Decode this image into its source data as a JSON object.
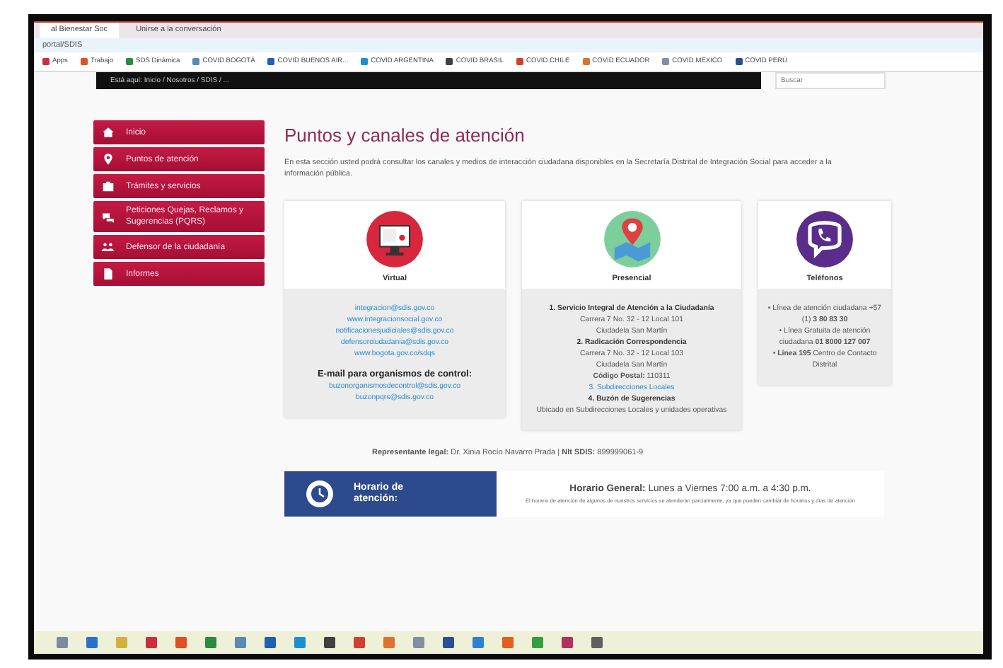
{
  "browser": {
    "tabs": [
      {
        "label": "al Bienestar Soc",
        "selected": true
      },
      {
        "label": "Unirse a la conversación",
        "selected": false
      }
    ],
    "address": "portal/SDIS",
    "bookmarks": [
      "Apps",
      "Trabajo",
      "SDS Dinámica",
      "COVID BOGOTÁ",
      "COVID BUENOS AIR...",
      "COVID ARGENTINA",
      "COVID BRASIL",
      "COVID CHILE",
      "COVID ECUADOR",
      "COVID MÉXICO",
      "COVID PERÚ"
    ]
  },
  "breadcrumb": "Está aquí: Inicio / Nosotros / SDIS / ...",
  "search": {
    "placeholder": "Buscar"
  },
  "sidebar": {
    "items": [
      {
        "label": "Inicio"
      },
      {
        "label": "Puntos de atención"
      },
      {
        "label": "Trámites y servicios"
      },
      {
        "label": "Peticiones Quejas, Reclamos y Sugerencias (PQRS)"
      },
      {
        "label": "Defensor de la ciudadanía"
      },
      {
        "label": "Informes"
      }
    ]
  },
  "heading": "Puntos y canales de atención",
  "intro": "En esta sección usted podrá consultar los canales y medios de interacción ciudadana disponibles en la Secretaría Distrital de Integración Social para acceder a la información pública.",
  "cards": [
    {
      "kind": "virtual",
      "title": "Virtual",
      "lines": [
        {
          "kind": "link",
          "text": "integracion@sdis.gov.co"
        },
        {
          "kind": "link",
          "text": "www.integracionsocial.gov.co"
        },
        {
          "kind": "link",
          "text": "notificacionesjudiciales@sdis.gov.co"
        },
        {
          "kind": "link",
          "text": "defensorciudadania@sdis.gov.co"
        },
        {
          "kind": "link",
          "text": "www.bogota.gov.co/sdqs"
        },
        {
          "kind": "heading",
          "text": "E-mail para organismos de control:"
        },
        {
          "kind": "link",
          "text": "buzonorganismosdecontrol@sdis.gov.co"
        },
        {
          "kind": "link",
          "text": "buzonpqrs@sdis.gov.co"
        }
      ]
    },
    {
      "kind": "presencial",
      "title": "Presencial",
      "lines": [
        {
          "kind": "bold",
          "text": "1. Servicio Integral de Atención a la Ciudadanía"
        },
        {
          "kind": "text",
          "text": "Carrera 7 No. 32 - 12 Local 101"
        },
        {
          "kind": "text",
          "text": "Ciudadela San Martín"
        },
        {
          "kind": "bold",
          "text": "2. Radicación Correspondencia"
        },
        {
          "kind": "text",
          "text": "Carrera 7 No. 32 - 12 Local 103"
        },
        {
          "kind": "text",
          "text": "Ciudadela San Martín"
        },
        {
          "kind": "text",
          "text": "**Código Postal:** 110311"
        },
        {
          "kind": "link",
          "text": "3. Subdirecciones Locales"
        },
        {
          "kind": "bold",
          "text": "4. Buzón de Sugerencias"
        },
        {
          "kind": "text",
          "text": "Ubicado en Subdirecciones Locales y unidades operativas"
        }
      ]
    },
    {
      "kind": "telefono",
      "title": "Teléfonos",
      "lines": [
        {
          "kind": "text",
          "text": "• Línea de atención ciudadana +57 (1) **3 80 83 30**"
        },
        {
          "kind": "text",
          "text": "• Línea Gratuita de atención ciudadana **01 8000 127 007**"
        },
        {
          "kind": "text",
          "text": "• **Línea 195** Centro de Contacto Distrital"
        }
      ]
    }
  ],
  "legal": "**Representante legal:** Dr. Xinia Rocío Navarro Prada | **NIt SDIS:** 899999061-9",
  "schedule": {
    "label": "Horario de atención:",
    "title": "**Horario General:** Lunes a Viernes 7:00 a.m. a 4:30 p.m.",
    "note": "El horario de atención de algunos de nuestros servicios se atenderán parcialmente, ya que pueden cambiar de horarios y días de atención"
  }
}
